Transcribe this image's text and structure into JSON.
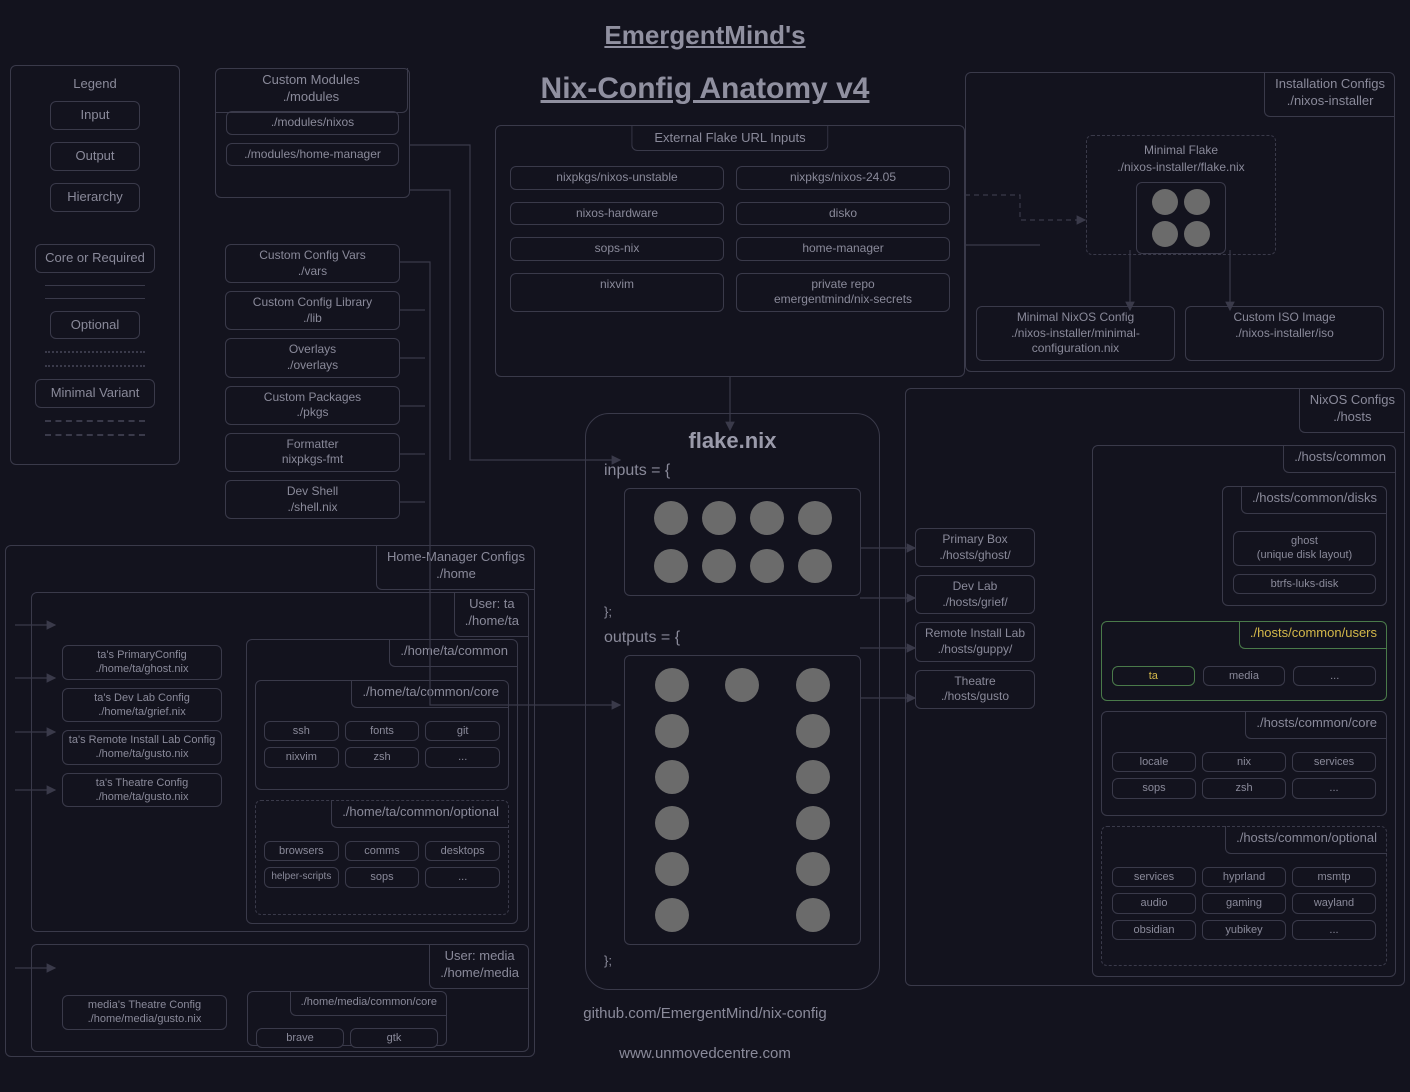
{
  "title": {
    "line1": "EmergentMind's",
    "line2": "Nix-Config Anatomy v4"
  },
  "legend": {
    "header": "Legend",
    "input": "Input",
    "output": "Output",
    "hierarchy": "Hierarchy",
    "core": "Core or Required",
    "optional": "Optional",
    "minimal": "Minimal Variant"
  },
  "custom_modules": {
    "header_line1": "Custom Modules",
    "header_line2": "./modules",
    "items": [
      "./modules/nixos",
      "./modules/home-manager"
    ]
  },
  "side_modules": {
    "vars": {
      "l1": "Custom Config Vars",
      "l2": "./vars"
    },
    "lib": {
      "l1": "Custom Config Library",
      "l2": "./lib"
    },
    "overlays": {
      "l1": "Overlays",
      "l2": "./overlays"
    },
    "pkgs": {
      "l1": "Custom Packages",
      "l2": "./pkgs"
    },
    "formatter": {
      "l1": "Formatter",
      "l2": "nixpkgs-fmt"
    },
    "shell": {
      "l1": "Dev Shell",
      "l2": "./shell.nix"
    }
  },
  "external_flake": {
    "header": "External Flake URL Inputs",
    "items": {
      "unstable": "nixpkgs/nixos-unstable",
      "stable": "nixpkgs/nixos-24.05",
      "hardware": "nixos-hardware",
      "disko": "disko",
      "sops": "sops-nix",
      "hm": "home-manager",
      "nixvim": "nixvim",
      "private_l1": "private repo",
      "private_l2": "emergentmind/nix-secrets"
    }
  },
  "installation": {
    "header_l1": "Installation Configs",
    "header_l2": "./nixos-installer",
    "minimal_flake_l1": "Minimal Flake",
    "minimal_flake_l2": "./nixos-installer/flake.nix",
    "minimal_cfg_l1": "Minimal NixOS Config",
    "minimal_cfg_l2": "./nixos-installer/minimal-configuration.nix",
    "iso_l1": "Custom ISO Image",
    "iso_l2": "./nixos-installer/iso"
  },
  "flake": {
    "title": "flake.nix",
    "inputs_open": "inputs = {",
    "close": "};",
    "outputs_open": "outputs = {"
  },
  "footer": {
    "repo": "github.com/EmergentMind/nix-config",
    "site": "www.unmovedcentre.com"
  },
  "hosts": {
    "primary_l1": "Primary Box",
    "primary_l2": "./hosts/ghost/",
    "dev_l1": "Dev Lab",
    "dev_l2": "./hosts/grief/",
    "remote_l1": "Remote Install Lab",
    "remote_l2": "./hosts/guppy/",
    "theatre_l1": "Theatre",
    "theatre_l2": "./hosts/gusto"
  },
  "nixos_configs": {
    "header_l1": "NixOS Configs",
    "header_l2": "./hosts",
    "common": "./hosts/common",
    "disks_header": "./hosts/common/disks",
    "disks_ghost_l1": "ghost",
    "disks_ghost_l2": "(unique disk layout)",
    "disks_btrfs": "btrfs-luks-disk",
    "users_header": "./hosts/common/users",
    "users": {
      "ta": "ta",
      "media": "media",
      "more": "..."
    },
    "core_header": "./hosts/common/core",
    "core": {
      "locale": "locale",
      "nix": "nix",
      "services": "services",
      "sops": "sops",
      "zsh": "zsh",
      "more": "..."
    },
    "optional_header": "./hosts/common/optional",
    "optional": {
      "services": "services",
      "hyprland": "hyprland",
      "msmtp": "msmtp",
      "audio": "audio",
      "gaming": "gaming",
      "wayland": "wayland",
      "obsidian": "obsidian",
      "yubikey": "yubikey",
      "more": "..."
    }
  },
  "hm_configs": {
    "header_l1": "Home-Manager Configs",
    "header_l2": "./home",
    "user_ta_l1": "User: ta",
    "user_ta_l2": "./home/ta",
    "user_media_l1": "User: media",
    "user_media_l2": "./home/media",
    "ta_configs": {
      "primary_l1": "ta's PrimaryConfig",
      "primary_l2": "./home/ta/ghost.nix",
      "dev_l1": "ta's Dev Lab Config",
      "dev_l2": "./home/ta/grief.nix",
      "remote_l1": "ta's Remote Install Lab Config",
      "remote_l2": "./home/ta/gusto.nix",
      "theatre_l1": "ta's Theatre Config",
      "theatre_l2": "./home/ta/gusto.nix"
    },
    "ta_common": {
      "header": "./home/ta/common",
      "core_header": "./home/ta/common/core",
      "core": {
        "ssh": "ssh",
        "fonts": "fonts",
        "git": "git",
        "nixvim": "nixvim",
        "zsh": "zsh",
        "more": "..."
      },
      "optional_header": "./home/ta/common/optional",
      "optional": {
        "browsers": "browsers",
        "comms": "comms",
        "desktops": "desktops",
        "helper": "helper-scripts",
        "sops": "sops",
        "more": "..."
      }
    },
    "media_configs": {
      "theatre_l1": "media's Theatre Config",
      "theatre_l2": "./home/media/gusto.nix"
    },
    "media_common": {
      "core_header": "./home/media/common/core",
      "core": {
        "brave": "brave",
        "gtk": "gtk"
      }
    }
  }
}
